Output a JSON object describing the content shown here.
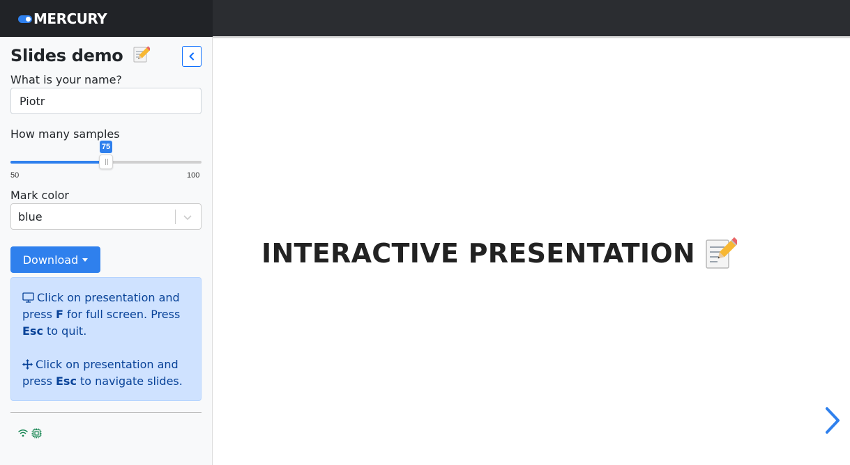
{
  "brand": {
    "name": "MERCURY"
  },
  "sidebar": {
    "title": "Slides demo",
    "name_field": {
      "label": "What is your name?",
      "value": "Piotr"
    },
    "samples": {
      "label": "How many samples",
      "value": "75",
      "min": "50",
      "max": "100",
      "fraction": 0.5
    },
    "mark_color": {
      "label": "Mark color",
      "selected": "blue"
    },
    "download": {
      "label": "Download"
    },
    "info": {
      "p1_pre": "Click on presentation and press ",
      "p1_key1": "F",
      "p1_mid": " for full screen. Press ",
      "p1_key2": "Esc",
      "p1_post": " to quit.",
      "p2_pre": "Click on presentation and press ",
      "p2_key": "Esc",
      "p2_post": " to navigate slides."
    }
  },
  "slide": {
    "title": "INTERACTIVE PRESENTATION"
  },
  "colors": {
    "accent": "#2f80ed",
    "navbar": "#212327",
    "info_bg": "#cfe2ff",
    "info_text": "#084298"
  },
  "icons": [
    "toggle-icon",
    "chevron-left-icon",
    "chevron-down-icon",
    "desktop-icon",
    "arrows-move-icon",
    "wifi-icon",
    "chip-icon",
    "pencil-memo-icon",
    "chevron-right-icon"
  ]
}
